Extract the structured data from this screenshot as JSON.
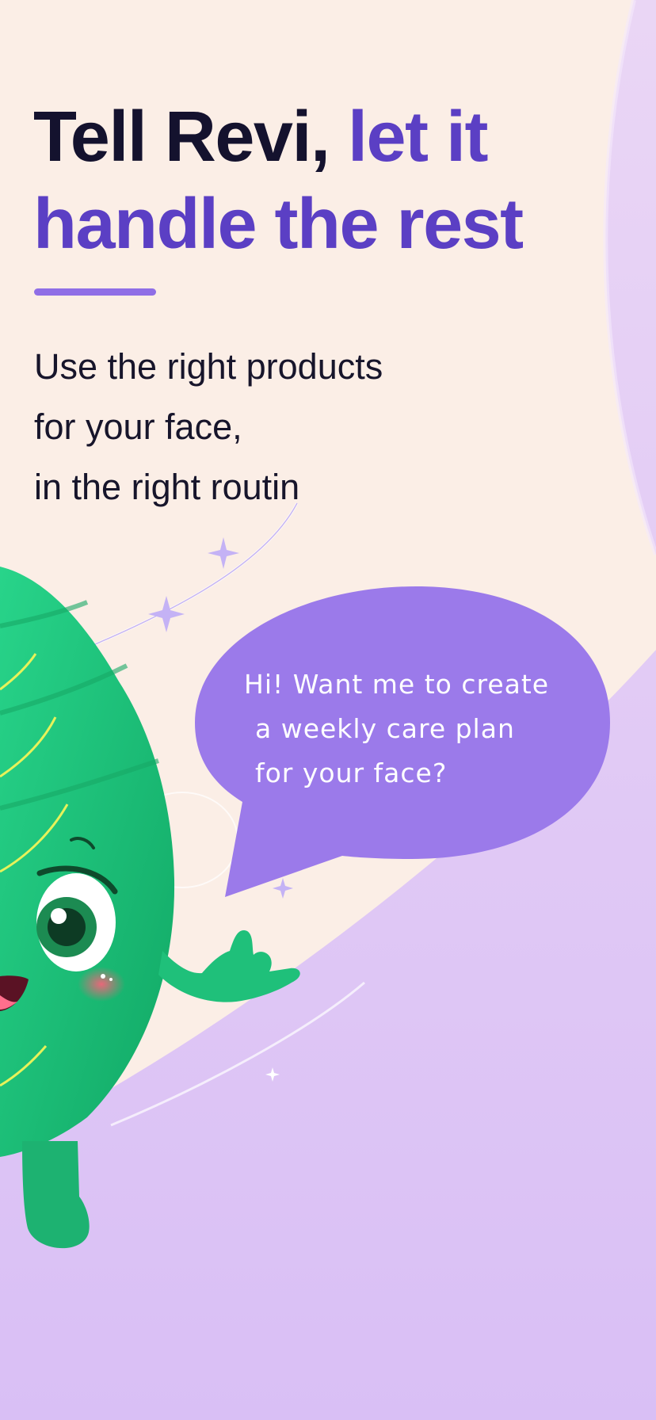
{
  "headline": {
    "part1": "Tell Revi, ",
    "part2": "let it handle the rest"
  },
  "subtitle": {
    "line1": "Use the right products",
    "line2": "for your face,",
    "line3": "in the right routin"
  },
  "speech_bubble": {
    "line1": "Hi! Want me to create",
    "line2": "a weekly care plan",
    "line3": "for your face?"
  },
  "colors": {
    "background": "#fbeee6",
    "lavender": "#dcc2f4",
    "headline_dark": "#14122e",
    "headline_accent": "#5b3fc4",
    "divider": "#8f6ee6",
    "bubble": "#9b7aea",
    "mascot_green": "#1fc07a"
  }
}
